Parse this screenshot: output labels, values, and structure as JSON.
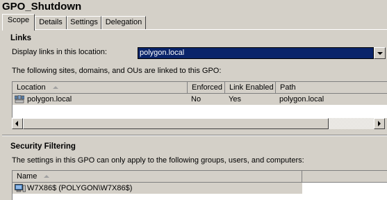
{
  "gpo_name": "GPO_Shutdown",
  "tabs": [
    {
      "label": "Scope",
      "active": true
    },
    {
      "label": "Details",
      "active": false
    },
    {
      "label": "Settings",
      "active": false
    },
    {
      "label": "Delegation",
      "active": false
    }
  ],
  "links": {
    "heading": "Links",
    "display_label": "Display links in this location:",
    "location_value": "polygon.local",
    "linked_text": "The following sites, domains, and OUs are linked to this GPO:",
    "columns": [
      "Location",
      "Enforced",
      "Link Enabled",
      "Path"
    ],
    "rows": [
      {
        "location": "polygon.local",
        "enforced": "No",
        "link_enabled": "Yes",
        "path": "polygon.local",
        "icon": "domain-icon"
      }
    ]
  },
  "security": {
    "heading": "Security Filtering",
    "description": "The settings in this GPO can only apply to the following groups, users, and computers:",
    "columns": [
      "Name"
    ],
    "rows": [
      {
        "name": "W7X86$ (POLYGON\\W7X86$)",
        "icon": "computer-icon"
      }
    ]
  },
  "colors": {
    "selection": "#0a246a",
    "face": "#d4d0c8"
  }
}
